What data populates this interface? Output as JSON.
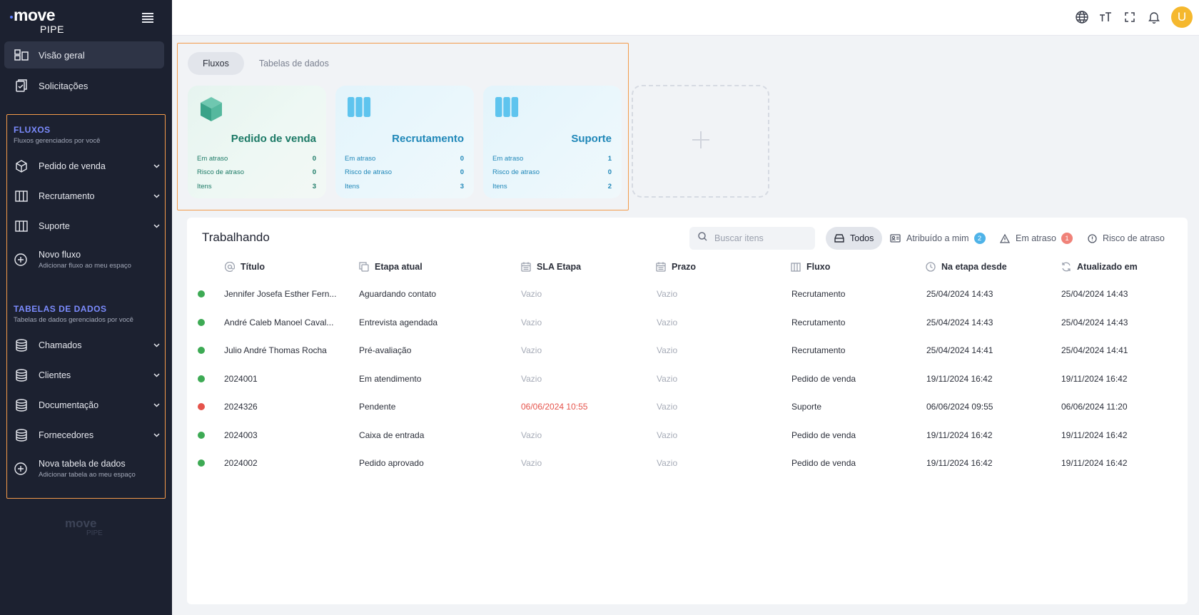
{
  "app": {
    "logo_main": "move",
    "logo_sub": "PIPE"
  },
  "sidebar": {
    "nav": [
      {
        "label": "Visão geral",
        "icon": "dashboard-icon"
      },
      {
        "label": "Solicitações",
        "icon": "clipboard-icon"
      }
    ],
    "flows_title": "FLUXOS",
    "flows_sub": "Fluxos gerenciados por você",
    "flows": [
      {
        "label": "Pedido de venda",
        "icon": "cube-icon"
      },
      {
        "label": "Recrutamento",
        "icon": "columns-icon"
      },
      {
        "label": "Suporte",
        "icon": "columns-icon"
      }
    ],
    "new_flow": {
      "title": "Novo fluxo",
      "sub": "Adicionar fluxo ao meu espaço"
    },
    "tables_title": "TABELAS DE DADOS",
    "tables_sub": "Tabelas de dados gerenciados por você",
    "tables": [
      {
        "label": "Chamados"
      },
      {
        "label": "Clientes"
      },
      {
        "label": "Documentação"
      },
      {
        "label": "Fornecedores"
      }
    ],
    "new_table": {
      "title": "Nova tabela de dados",
      "sub": "Adicionar tabela ao meu espaço"
    }
  },
  "topbar": {
    "avatar_initial": "U"
  },
  "flows_panel": {
    "tabs": [
      "Fluxos",
      "Tabelas de dados"
    ],
    "cards": [
      {
        "name": "Pedido de venda",
        "theme": "green",
        "color": "#1c7a66",
        "icon": "cube-icon",
        "rows": [
          {
            "label": "Em atraso",
            "value": "0"
          },
          {
            "label": "Risco de atraso",
            "value": "0"
          },
          {
            "label": "Itens",
            "value": "3"
          }
        ]
      },
      {
        "name": "Recrutamento",
        "theme": "blue",
        "color": "#1f87b8",
        "icon": "columns-icon",
        "rows": [
          {
            "label": "Em atraso",
            "value": "0"
          },
          {
            "label": "Risco de atraso",
            "value": "0"
          },
          {
            "label": "Itens",
            "value": "3"
          }
        ]
      },
      {
        "name": "Suporte",
        "theme": "blue",
        "color": "#1f87b8",
        "icon": "columns-icon",
        "rows": [
          {
            "label": "Em atraso",
            "value": "1"
          },
          {
            "label": "Risco de atraso",
            "value": "0"
          },
          {
            "label": "Itens",
            "value": "2"
          }
        ]
      }
    ]
  },
  "work": {
    "title": "Trabalhando",
    "search_placeholder": "Buscar itens",
    "filters": {
      "all": "Todos",
      "assigned": "Atribuído a mim",
      "assigned_count": "2",
      "late": "Em atraso",
      "late_count": "1",
      "risk": "Risco de atraso"
    },
    "columns": [
      "Título",
      "Etapa atual",
      "SLA Etapa",
      "Prazo",
      "Fluxo",
      "Na etapa desde",
      "Atualizado em"
    ],
    "rows": [
      {
        "status": "green",
        "titulo": "Jennifer Josefa Esther Fern...",
        "etapa": "Aguardando contato",
        "sla": "Vazio",
        "prazo": "Vazio",
        "fluxo": "Recrutamento",
        "desde": "25/04/2024 14:43",
        "atualizado": "25/04/2024 14:43"
      },
      {
        "status": "green",
        "titulo": "André Caleb Manoel Caval...",
        "etapa": "Entrevista agendada",
        "sla": "Vazio",
        "prazo": "Vazio",
        "fluxo": "Recrutamento",
        "desde": "25/04/2024 14:43",
        "atualizado": "25/04/2024 14:43"
      },
      {
        "status": "green",
        "titulo": "Julio André Thomas Rocha",
        "etapa": "Pré-avaliação",
        "sla": "Vazio",
        "prazo": "Vazio",
        "fluxo": "Recrutamento",
        "desde": "25/04/2024 14:41",
        "atualizado": "25/04/2024 14:41"
      },
      {
        "status": "green",
        "titulo": "2024001",
        "etapa": "Em atendimento",
        "sla": "Vazio",
        "prazo": "Vazio",
        "fluxo": "Pedido de venda",
        "desde": "19/11/2024 16:42",
        "atualizado": "19/11/2024 16:42"
      },
      {
        "status": "red",
        "titulo": "2024326",
        "etapa": "Pendente",
        "sla": "06/06/2024 10:55",
        "sla_late": true,
        "prazo": "Vazio",
        "fluxo": "Suporte",
        "desde": "06/06/2024 09:55",
        "atualizado": "06/06/2024 11:20"
      },
      {
        "status": "green",
        "titulo": "2024003",
        "etapa": "Caixa de entrada",
        "sla": "Vazio",
        "prazo": "Vazio",
        "fluxo": "Pedido de venda",
        "desde": "19/11/2024 16:42",
        "atualizado": "19/11/2024 16:42"
      },
      {
        "status": "green",
        "titulo": "2024002",
        "etapa": "Pedido aprovado",
        "sla": "Vazio",
        "prazo": "Vazio",
        "fluxo": "Pedido de venda",
        "desde": "19/11/2024 16:42",
        "atualizado": "19/11/2024 16:42"
      }
    ]
  },
  "colors": {
    "sidebar_bg": "#1c2130",
    "accent": "#7c8cff",
    "highlight": "#f39a4a",
    "ok": "#3daa54",
    "late": "#e5534b",
    "badge_blue": "#4fb3e8",
    "badge_red": "#f08279"
  }
}
